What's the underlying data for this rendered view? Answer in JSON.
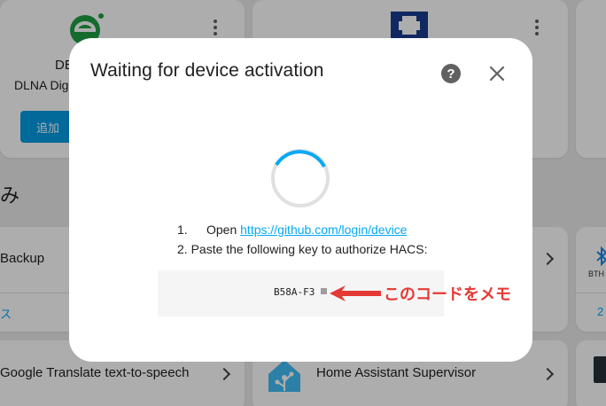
{
  "background": {
    "card1": {
      "title": "DE",
      "subtitle": "DLNA Digi",
      "button_label": "追加"
    },
    "section_label": "み",
    "backup_label": "Backup",
    "backup_link": "ス",
    "bth_label": "BTH",
    "bth_link": "2",
    "google_label": "Google Translate text-to-speech",
    "supervisor_label": "Home Assistant Supervisor"
  },
  "dialog": {
    "title": "Waiting for device activation",
    "step1_num": "1.",
    "step1_text": "Open ",
    "step1_link": "https://github.com/login/device",
    "step2_text": "2. Paste the following key to authorize HACS:",
    "code": "B58A-F3",
    "help_icon": "help-circle-icon",
    "close_icon": "close-icon"
  },
  "annotation": {
    "text": "このコードをメモ",
    "color": "#e53935"
  },
  "colors": {
    "accent": "#03a9f4",
    "button": "#039be5",
    "annotation": "#e53935"
  }
}
